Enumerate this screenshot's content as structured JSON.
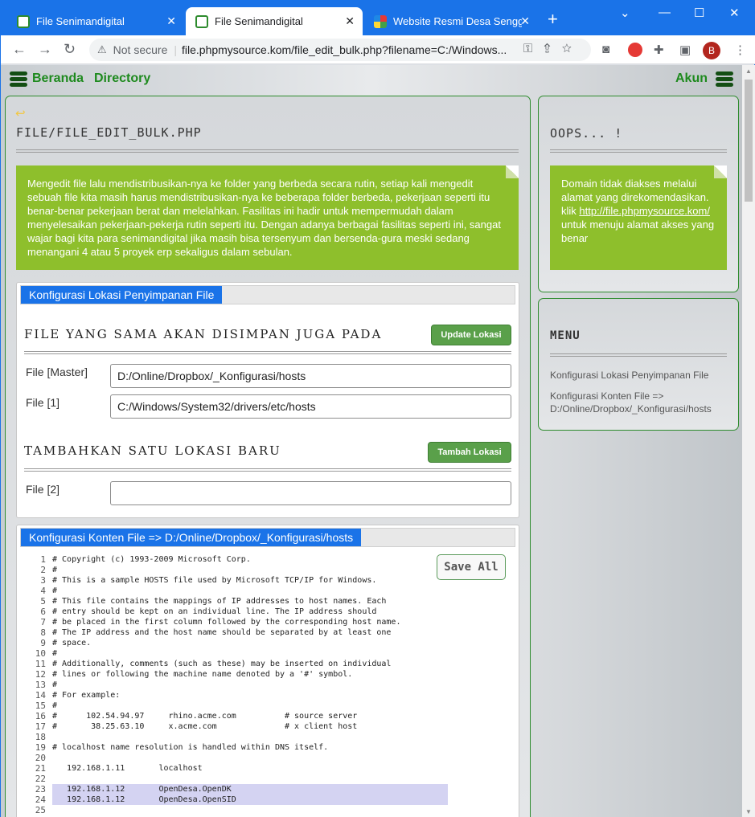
{
  "browser": {
    "tabs": [
      {
        "title": "File Senimandigital",
        "active": false
      },
      {
        "title": "File Senimandigital",
        "active": true
      },
      {
        "title": "Website Resmi Desa Sengg",
        "active": false
      }
    ],
    "security": "Not secure",
    "url": "file.phpmysource.kom/file_edit_bulk.php?filename=C:/Windows...",
    "profile_initial": "B"
  },
  "topnav": {
    "beranda": "Beranda",
    "directory": "Directory",
    "akun": "Akun"
  },
  "main": {
    "back_icon": "back-arrow-icon",
    "title": "FILE/FILE_EDIT_BULK.PHP",
    "intro": "Mengedit file lalu mendistribusikan-nya ke folder yang berbeda secara rutin, setiap kali mengedit sebuah file kita masih harus mendistribusikan-nya ke beberapa folder berbeda, pekerjaan seperti itu benar-benar pekerjaan berat dan melelahkan. Fasilitas ini hadir untuk mempermudah dalam menyelesaikan pekerjaan-pekerja rutin seperti itu. Dengan adanya berbagai fasilitas seperti ini, sangat wajar bagi kita para senimandigital jika masih bisa tersenyum dan bersenda-gura meski sedang menangani 4 atau 5 proyek erp sekaligus dalam sebulan.",
    "lokasi": {
      "tab": "Konfigurasi Lokasi Penyimpanan File",
      "heading1": "FILE YANG SAMA AKAN DISIMPAN JUGA PADA",
      "update_btn": "Update Lokasi",
      "fields": [
        {
          "label": "File [Master]",
          "value": "D:/Online/Dropbox/_Konfigurasi/hosts"
        },
        {
          "label": "File [1]",
          "value": "C:/Windows/System32/drivers/etc/hosts"
        }
      ],
      "heading2": "TAMBAHKAN SATU LOKASI BARU",
      "tambah_btn": "Tambah Lokasi",
      "new_field": {
        "label": "File [2]",
        "value": ""
      }
    },
    "konten": {
      "tab": "Konfigurasi Konten File => D:/Online/Dropbox/_Konfigurasi/hosts",
      "save_btn": "Save All",
      "line_numbers": [
        "1",
        "2",
        "3",
        "4",
        "5",
        "6",
        "7",
        "8",
        "9",
        "10",
        "11",
        "12",
        "13",
        "14",
        "15",
        "16",
        "17",
        "18",
        "19",
        "20",
        "21",
        "22",
        "23",
        "24",
        "25"
      ],
      "lines": [
        "# Copyright (c) 1993-2009 Microsoft Corp.",
        "#",
        "# This is a sample HOSTS file used by Microsoft TCP/IP for Windows.",
        "#",
        "# This file contains the mappings of IP addresses to host names. Each",
        "# entry should be kept on an individual line. The IP address should",
        "# be placed in the first column followed by the corresponding host name.",
        "# The IP address and the host name should be separated by at least one",
        "# space.",
        "#",
        "# Additionally, comments (such as these) may be inserted on individual",
        "# lines or following the machine name denoted by a '#' symbol.",
        "#",
        "# For example:",
        "#",
        "#      102.54.94.97     rhino.acme.com          # source server",
        "#       38.25.63.10     x.acme.com              # x client host",
        "",
        "# localhost name resolution is handled within DNS itself.",
        "",
        "   192.168.1.11       localhost",
        "",
        "   192.168.1.12       OpenDesa.OpenDK",
        "   192.168.1.12       OpenDesa.OpenSID",
        ""
      ]
    }
  },
  "side": {
    "oops_title": "OOPS... !",
    "oops_text": "Domain tidak diakses melalui alamat yang direkomendasikan. klik",
    "oops_link": "http://file.phpmysource.kom/",
    "oops_text2": "untuk menuju alamat akses yang benar",
    "menu_title": "MENU",
    "menu_items": [
      "Konfigurasi Lokasi Penyimpanan File",
      "Konfigurasi Konten File => D:/Online/Dropbox/_Konfigurasi/hosts"
    ]
  }
}
